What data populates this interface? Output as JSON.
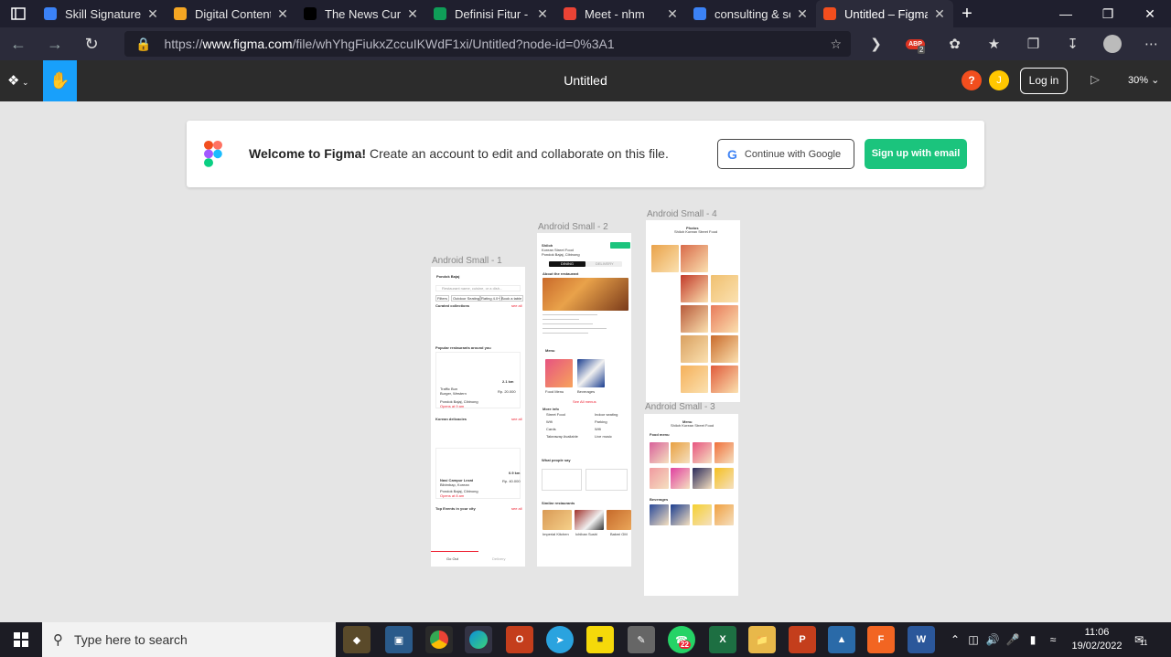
{
  "browser": {
    "tabs": [
      {
        "title": "Skill Signature - S",
        "favicon_color": "#3b82f6"
      },
      {
        "title": "Digital Content C",
        "favicon_color": "#f5a623"
      },
      {
        "title": "The News Curatio",
        "favicon_color": "#000000"
      },
      {
        "title": "Definisi Fitur - Go",
        "favicon_color": "#0f9d58"
      },
      {
        "title": "Meet - nhm",
        "favicon_color": "#ea4335"
      },
      {
        "title": "consulting & serv",
        "favicon_color": "#3b82f6"
      },
      {
        "title": "Untitled – Figma",
        "favicon_color": "#f24e1e"
      }
    ],
    "url_prefix": "https://",
    "url_domain": "www.figma.com",
    "url_path": "/file/whYhgFiukxZccuIKWdF1xi/Untitled?node-id=0%3A1",
    "ext_badge": "ABP",
    "ext_badge_count": "2"
  },
  "figma": {
    "title": "Untitled",
    "help_label": "?",
    "avatar_initial": "J",
    "login_label": "Log in",
    "zoom_label": "30%",
    "banner": {
      "welcome_bold": "Welcome to Figma!",
      "welcome_rest": " Create an account to edit and collaborate on this file.",
      "google_label": "Continue with Google",
      "email_label": "Sign up with email"
    },
    "frames": [
      {
        "label": "Android Small - 1"
      },
      {
        "label": "Android Small - 2"
      },
      {
        "label": "Android Small - 4"
      },
      {
        "label": "Android Small - 3"
      }
    ],
    "frame1": {
      "location": "Pondok Bajaj",
      "search_placeholder": "Restaurant name, cuisine, or a dish...",
      "filters": [
        "Filters",
        "Outdoor Seating",
        "Rating 4.0+",
        "Book a table"
      ],
      "curated": "Curated collections",
      "see_all": "see all",
      "popular": "Popular restaurants around you",
      "distance1": "2.1 km",
      "rest1": "Traffic Bun",
      "rest1_cuisine": "Burger, Western",
      "rest1_price": "Rp. 20.000",
      "rest1_loc": "Pondok Bajaj, Cibinong",
      "rest1_hours": "Opens at 9 am",
      "korean": "Korean delicacies",
      "distance2": "0.9 km",
      "rest2": "Nasi Campur Lezat",
      "rest2_cuisine": "Bibimbap, Korean",
      "rest2_price": "Rp. 40.000",
      "rest2_loc": "Pondok Bajaj, Cibinong",
      "rest2_hours": "Opens at 8 am",
      "events": "Top Events in your city",
      "nav1": "Go Out",
      "nav2": "Delivery"
    },
    "frame2": {
      "name": "Shiloh",
      "sub1": "Korean Street Food",
      "sub2": "Pondok Bajaj, Cibinong",
      "tab1": "DINING",
      "tab2": "DELIVERY",
      "about": "About the restaurant",
      "menu": "Menu",
      "food_menu": "Food Menu",
      "beverages": "Beverages",
      "see_all_menus": "See All menus",
      "more_info": "More info",
      "amenities_left": [
        "Street Food",
        "Wifi",
        "Cards",
        "Takeaway Available"
      ],
      "amenities_right": [
        "Indoor seating",
        "Parking",
        "Wifi",
        "Live music"
      ],
      "people_say": "What people say",
      "similar": "Similar restaurants",
      "similar_items": [
        "Imperial Kitchen",
        "Ichiban Sushi",
        "Bakmi GM"
      ]
    },
    "frame3": {
      "header": "Menu",
      "subheader": "Shiloh Korean Street Food",
      "food_menu": "Food menu",
      "beverages": "Beverages"
    },
    "frame4": {
      "header": "Photos",
      "subheader": "Shiloh Korean Street Food"
    }
  },
  "taskbar": {
    "search_placeholder": "Type here to search",
    "whatsapp_badge": "22",
    "time": "11:06",
    "date": "19/02/2022",
    "notif_count": "11"
  }
}
